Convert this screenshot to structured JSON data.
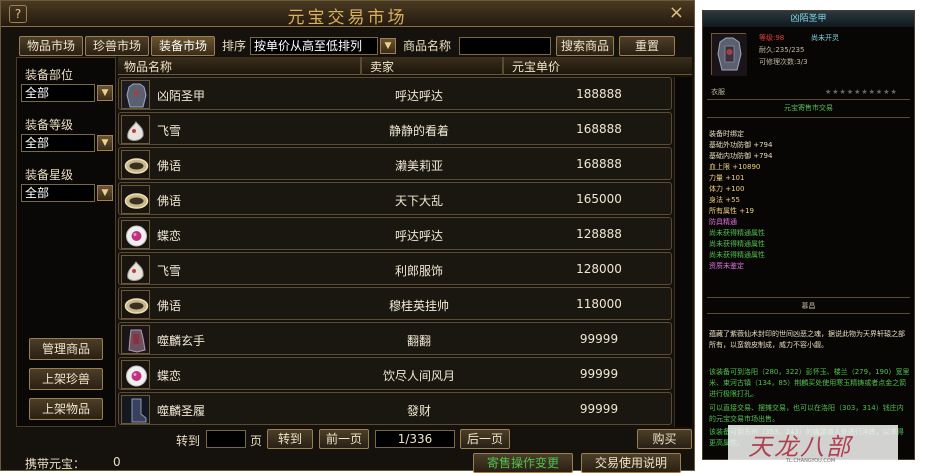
{
  "window": {
    "title": "元宝交易市场",
    "help_label": "?",
    "close_label": "×"
  },
  "tabs": [
    {
      "label": "物品市场",
      "active": false
    },
    {
      "label": "珍兽市场",
      "active": false
    },
    {
      "label": "装备市场",
      "active": true
    }
  ],
  "sort": {
    "label": "排序",
    "selected": "按单价从高至低排列"
  },
  "search": {
    "label": "商品名称",
    "value": "",
    "button": "搜索商品",
    "reset": "重置"
  },
  "filters": {
    "slot": {
      "label": "装备部位",
      "selected": "全部"
    },
    "level": {
      "label": "装备等级",
      "selected": "全部"
    },
    "star": {
      "label": "装备星级",
      "selected": "全部"
    }
  },
  "side_buttons": {
    "manage": "管理商品",
    "list_pet": "上架珍兽",
    "list_item": "上架物品"
  },
  "table": {
    "headers": {
      "name": "物品名称",
      "seller": "卖家",
      "price": "元宝单价"
    },
    "rows": [
      {
        "name": "凶陌圣甲",
        "seller": "呼达呼达",
        "price": "188888",
        "icon": "armor-icon"
      },
      {
        "name": "飞雪",
        "seller": "静静的看着",
        "price": "168888",
        "icon": "scroll-icon"
      },
      {
        "name": "佛语",
        "seller": "濑美莉亚",
        "price": "168888",
        "icon": "bracelet-icon"
      },
      {
        "name": "佛语",
        "seller": "天下大乱",
        "price": "165000",
        "icon": "bracelet-icon"
      },
      {
        "name": "蝶恋",
        "seller": "呼达呼达",
        "price": "128888",
        "icon": "gem-ring-icon"
      },
      {
        "name": "飞雪",
        "seller": "利郎服饰",
        "price": "128000",
        "icon": "scroll-icon"
      },
      {
        "name": "佛语",
        "seller": "穆桂英挂帅",
        "price": "118000",
        "icon": "bracelet-icon"
      },
      {
        "name": "噬麟玄手",
        "seller": "翻翻",
        "price": "99999",
        "icon": "gauntlet-icon"
      },
      {
        "name": "蝶恋",
        "seller": "饮尽人间风月",
        "price": "99999",
        "icon": "gem-ring-icon"
      },
      {
        "name": "噬麟圣履",
        "seller": "發财",
        "price": "99999",
        "icon": "boots-icon"
      }
    ]
  },
  "pager": {
    "goto_label": "转到",
    "page_unit": "页",
    "goto_button": "转到",
    "prev": "前一页",
    "page_info": "1/336",
    "next": "后一页",
    "buy": "购买"
  },
  "bottom": {
    "left_text": "携带元宝：",
    "left_value": "0",
    "btn1": "寄售操作变更",
    "btn2": "交易使用说明"
  },
  "tooltip": {
    "title": "凶陌圣甲",
    "level": "等级:98",
    "status": "尚未开灵",
    "durability": "耐久:235/235",
    "repair": "可修理次数:3/3",
    "slot": "衣服",
    "stars": "★★★★★★★★★★",
    "market_note": "元宝寄售市交易",
    "bind": "装备时绑定",
    "attrs": [
      {
        "text": "基础外功防御 +794",
        "color": "#e8dcc0"
      },
      {
        "text": "基础内功防御 +794",
        "color": "#e8dcc0"
      },
      {
        "text": "血上限 +10890",
        "color": "#f0d080"
      },
      {
        "text": "力量 +101",
        "color": "#f0d080"
      },
      {
        "text": "体力 +100",
        "color": "#f0d080"
      },
      {
        "text": "身法 +55",
        "color": "#f0d080"
      },
      {
        "text": "所有属性 +19",
        "color": "#f0d080"
      },
      {
        "text": "防具精通",
        "color": "#e070e0"
      },
      {
        "text": "尚未获得精通属性",
        "color": "#50c050"
      },
      {
        "text": "尚未获得精通属性",
        "color": "#50c050"
      },
      {
        "text": "尚未获得精通属性",
        "color": "#50c050"
      },
      {
        "text": "资质未鉴定",
        "color": "#e070e0"
      }
    ],
    "section_title": "慕昌",
    "desc1": "蕴藏了紫薇仙术封印的世间凶恶之魂，据说此物为天界轩辕之部所有，以蛮貌皮制成，威力不容小觑。",
    "desc2": "该装备可到洛阳（280，322）彭怀玉、楼兰（279，190）宽里米、束河古镇（134，85）荆麟买处使用寒玉精铸或者点金之箭进行极限打孔。",
    "desc3": "可以直接交易、摆摊交易，也可以在洛阳（303，314）钱庄内的元宝交易市场出售。",
    "desc4": "该装备可到苏州（353，243）的幽游道人处进行淬炼，以求得更高属性。"
  },
  "watermark": {
    "brand": "天龙八部",
    "url": "TL.CHANGYOU.COM"
  }
}
